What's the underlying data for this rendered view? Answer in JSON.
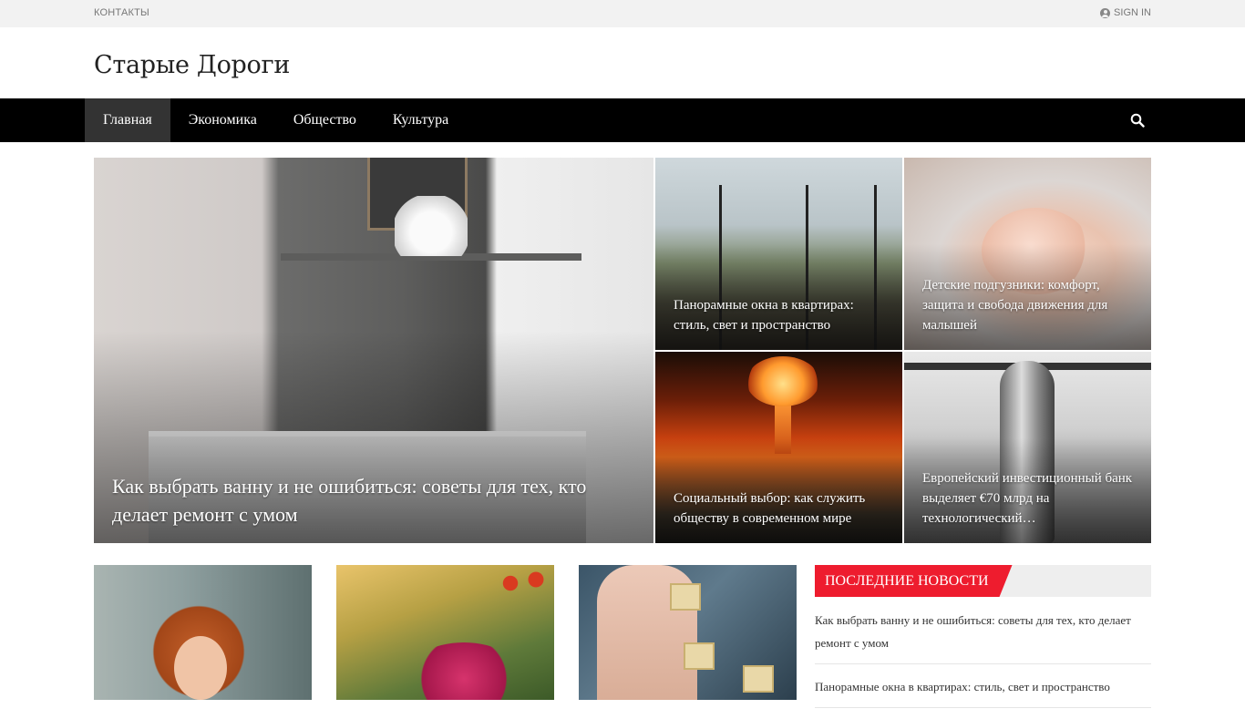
{
  "topbar": {
    "contacts": "КОНТАКТЫ",
    "signin": "SIGN IN"
  },
  "site": {
    "title": "Старые Дороги"
  },
  "nav": {
    "items": [
      {
        "label": "Главная",
        "active": true
      },
      {
        "label": "Экономика",
        "active": false
      },
      {
        "label": "Общество",
        "active": false
      },
      {
        "label": "Культура",
        "active": false
      }
    ],
    "search_icon": "search-icon"
  },
  "featured": [
    {
      "title": "Как выбрать ванну и не ошибиться: советы для тех, кто делает ремонт с умом"
    },
    {
      "title": "Панорамные окна в квартирах: стиль, свет и пространство"
    },
    {
      "title": "Детские подгузники: комфорт, защита и свобода движения для малышей"
    },
    {
      "title": "Социальный выбор: как служить обществу в современном мире"
    },
    {
      "title": "Европейский инвестиционный банк выделяет €70 млрд на технологический…"
    }
  ],
  "sidebar": {
    "heading": "ПОСЛЕДНИЕ НОВОСТИ",
    "items": [
      "Как выбрать ванну и не ошибиться: советы для тех, кто делает ремонт с умом",
      "Панорамные окна в квартирах: стиль, свет и пространство"
    ]
  },
  "colors": {
    "accent": "#ee1c2e",
    "navbar": "#000000",
    "nav_active": "#333333",
    "topbar": "#f2f2f2"
  }
}
